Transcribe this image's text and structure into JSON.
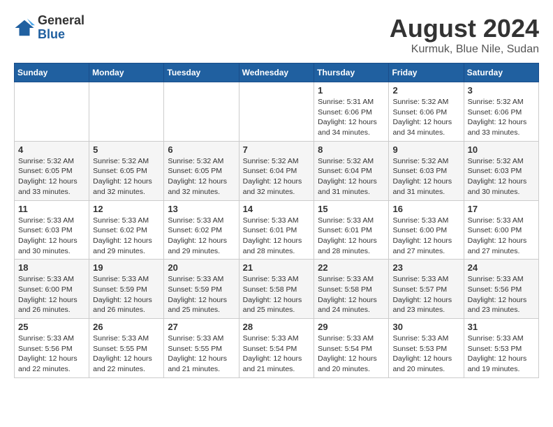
{
  "header": {
    "logo_general": "General",
    "logo_blue": "Blue",
    "title": "August 2024",
    "subtitle": "Kurmuk, Blue Nile, Sudan"
  },
  "days_of_week": [
    "Sunday",
    "Monday",
    "Tuesday",
    "Wednesday",
    "Thursday",
    "Friday",
    "Saturday"
  ],
  "weeks": [
    [
      {
        "day": "",
        "info": ""
      },
      {
        "day": "",
        "info": ""
      },
      {
        "day": "",
        "info": ""
      },
      {
        "day": "",
        "info": ""
      },
      {
        "day": "1",
        "info": "Sunrise: 5:31 AM\nSunset: 6:06 PM\nDaylight: 12 hours\nand 34 minutes."
      },
      {
        "day": "2",
        "info": "Sunrise: 5:32 AM\nSunset: 6:06 PM\nDaylight: 12 hours\nand 34 minutes."
      },
      {
        "day": "3",
        "info": "Sunrise: 5:32 AM\nSunset: 6:06 PM\nDaylight: 12 hours\nand 33 minutes."
      }
    ],
    [
      {
        "day": "4",
        "info": "Sunrise: 5:32 AM\nSunset: 6:05 PM\nDaylight: 12 hours\nand 33 minutes."
      },
      {
        "day": "5",
        "info": "Sunrise: 5:32 AM\nSunset: 6:05 PM\nDaylight: 12 hours\nand 32 minutes."
      },
      {
        "day": "6",
        "info": "Sunrise: 5:32 AM\nSunset: 6:05 PM\nDaylight: 12 hours\nand 32 minutes."
      },
      {
        "day": "7",
        "info": "Sunrise: 5:32 AM\nSunset: 6:04 PM\nDaylight: 12 hours\nand 32 minutes."
      },
      {
        "day": "8",
        "info": "Sunrise: 5:32 AM\nSunset: 6:04 PM\nDaylight: 12 hours\nand 31 minutes."
      },
      {
        "day": "9",
        "info": "Sunrise: 5:32 AM\nSunset: 6:03 PM\nDaylight: 12 hours\nand 31 minutes."
      },
      {
        "day": "10",
        "info": "Sunrise: 5:32 AM\nSunset: 6:03 PM\nDaylight: 12 hours\nand 30 minutes."
      }
    ],
    [
      {
        "day": "11",
        "info": "Sunrise: 5:33 AM\nSunset: 6:03 PM\nDaylight: 12 hours\nand 30 minutes."
      },
      {
        "day": "12",
        "info": "Sunrise: 5:33 AM\nSunset: 6:02 PM\nDaylight: 12 hours\nand 29 minutes."
      },
      {
        "day": "13",
        "info": "Sunrise: 5:33 AM\nSunset: 6:02 PM\nDaylight: 12 hours\nand 29 minutes."
      },
      {
        "day": "14",
        "info": "Sunrise: 5:33 AM\nSunset: 6:01 PM\nDaylight: 12 hours\nand 28 minutes."
      },
      {
        "day": "15",
        "info": "Sunrise: 5:33 AM\nSunset: 6:01 PM\nDaylight: 12 hours\nand 28 minutes."
      },
      {
        "day": "16",
        "info": "Sunrise: 5:33 AM\nSunset: 6:00 PM\nDaylight: 12 hours\nand 27 minutes."
      },
      {
        "day": "17",
        "info": "Sunrise: 5:33 AM\nSunset: 6:00 PM\nDaylight: 12 hours\nand 27 minutes."
      }
    ],
    [
      {
        "day": "18",
        "info": "Sunrise: 5:33 AM\nSunset: 6:00 PM\nDaylight: 12 hours\nand 26 minutes."
      },
      {
        "day": "19",
        "info": "Sunrise: 5:33 AM\nSunset: 5:59 PM\nDaylight: 12 hours\nand 26 minutes."
      },
      {
        "day": "20",
        "info": "Sunrise: 5:33 AM\nSunset: 5:59 PM\nDaylight: 12 hours\nand 25 minutes."
      },
      {
        "day": "21",
        "info": "Sunrise: 5:33 AM\nSunset: 5:58 PM\nDaylight: 12 hours\nand 25 minutes."
      },
      {
        "day": "22",
        "info": "Sunrise: 5:33 AM\nSunset: 5:58 PM\nDaylight: 12 hours\nand 24 minutes."
      },
      {
        "day": "23",
        "info": "Sunrise: 5:33 AM\nSunset: 5:57 PM\nDaylight: 12 hours\nand 23 minutes."
      },
      {
        "day": "24",
        "info": "Sunrise: 5:33 AM\nSunset: 5:56 PM\nDaylight: 12 hours\nand 23 minutes."
      }
    ],
    [
      {
        "day": "25",
        "info": "Sunrise: 5:33 AM\nSunset: 5:56 PM\nDaylight: 12 hours\nand 22 minutes."
      },
      {
        "day": "26",
        "info": "Sunrise: 5:33 AM\nSunset: 5:55 PM\nDaylight: 12 hours\nand 22 minutes."
      },
      {
        "day": "27",
        "info": "Sunrise: 5:33 AM\nSunset: 5:55 PM\nDaylight: 12 hours\nand 21 minutes."
      },
      {
        "day": "28",
        "info": "Sunrise: 5:33 AM\nSunset: 5:54 PM\nDaylight: 12 hours\nand 21 minutes."
      },
      {
        "day": "29",
        "info": "Sunrise: 5:33 AM\nSunset: 5:54 PM\nDaylight: 12 hours\nand 20 minutes."
      },
      {
        "day": "30",
        "info": "Sunrise: 5:33 AM\nSunset: 5:53 PM\nDaylight: 12 hours\nand 20 minutes."
      },
      {
        "day": "31",
        "info": "Sunrise: 5:33 AM\nSunset: 5:53 PM\nDaylight: 12 hours\nand 19 minutes."
      }
    ]
  ]
}
